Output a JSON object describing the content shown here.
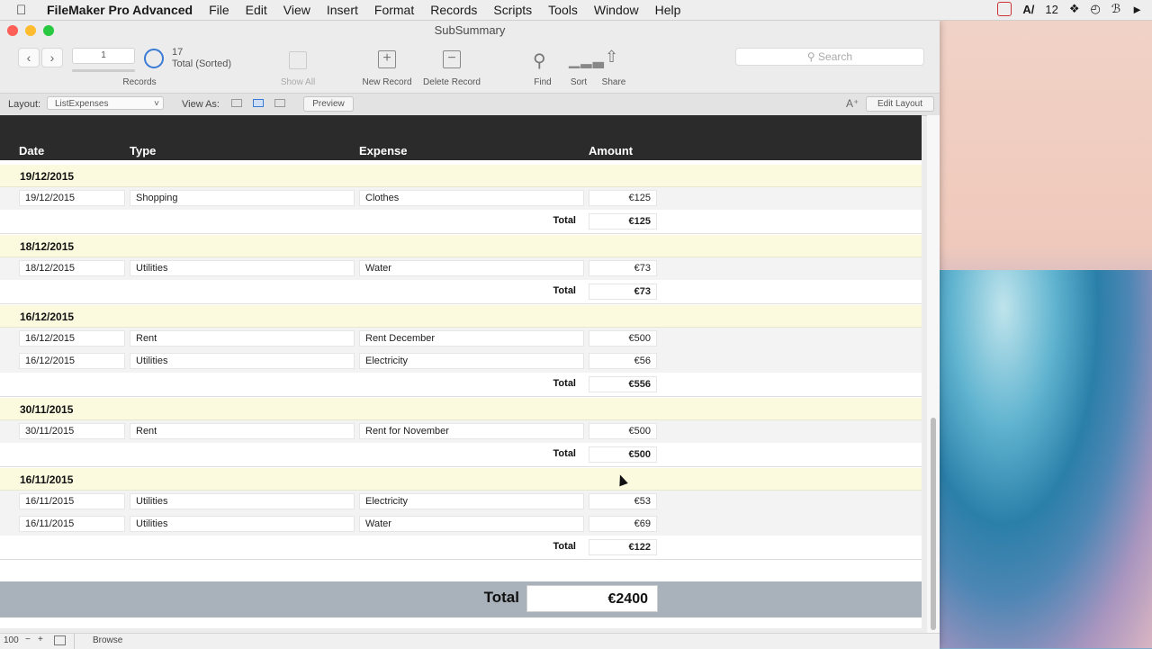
{
  "menubar": {
    "app_name": "FileMaker Pro Advanced",
    "items": [
      "File",
      "Edit",
      "View",
      "Insert",
      "Format",
      "Records",
      "Scripts",
      "Tools",
      "Window",
      "Help"
    ],
    "tray_count": "12"
  },
  "window": {
    "title": "SubSummary"
  },
  "toolbar": {
    "record_number": "1",
    "found_count": "17",
    "found_status": "Total (Sorted)",
    "records_label": "Records",
    "show_all_label": "Show All",
    "new_record_label": "New Record",
    "delete_record_label": "Delete Record",
    "find_label": "Find",
    "sort_label": "Sort",
    "share_label": "Share",
    "search_placeholder": "Search"
  },
  "layoutbar": {
    "layout_label": "Layout:",
    "layout_value": "ListExpenses",
    "view_as_label": "View As:",
    "preview_label": "Preview",
    "edit_layout_label": "Edit Layout"
  },
  "table": {
    "headers": {
      "date": "Date",
      "type": "Type",
      "expense": "Expense",
      "amount": "Amount"
    },
    "subtotal_label": "Total",
    "groups": [
      {
        "date": "19/12/2015",
        "rows": [
          {
            "date": "19/12/2015",
            "type": "Shopping",
            "expense": "Clothes",
            "amount": "€125"
          }
        ],
        "total": "€125"
      },
      {
        "date": "18/12/2015",
        "rows": [
          {
            "date": "18/12/2015",
            "type": "Utilities",
            "expense": "Water",
            "amount": "€73"
          }
        ],
        "total": "€73"
      },
      {
        "date": "16/12/2015",
        "rows": [
          {
            "date": "16/12/2015",
            "type": "Rent",
            "expense": "Rent December",
            "amount": "€500"
          },
          {
            "date": "16/12/2015",
            "type": "Utilities",
            "expense": "Electricity",
            "amount": "€56"
          }
        ],
        "total": "€556"
      },
      {
        "date": "30/11/2015",
        "rows": [
          {
            "date": "30/11/2015",
            "type": "Rent",
            "expense": "Rent for November",
            "amount": "€500"
          }
        ],
        "total": "€500"
      },
      {
        "date": "16/11/2015",
        "rows": [
          {
            "date": "16/11/2015",
            "type": "Utilities",
            "expense": "Electricity",
            "amount": "€53"
          },
          {
            "date": "16/11/2015",
            "type": "Utilities",
            "expense": "Water",
            "amount": "€69"
          }
        ],
        "total": "€122"
      }
    ],
    "grand_total_label": "Total",
    "grand_total": "€2400"
  },
  "statusbar": {
    "zoom": "100",
    "mode": "Browse"
  }
}
